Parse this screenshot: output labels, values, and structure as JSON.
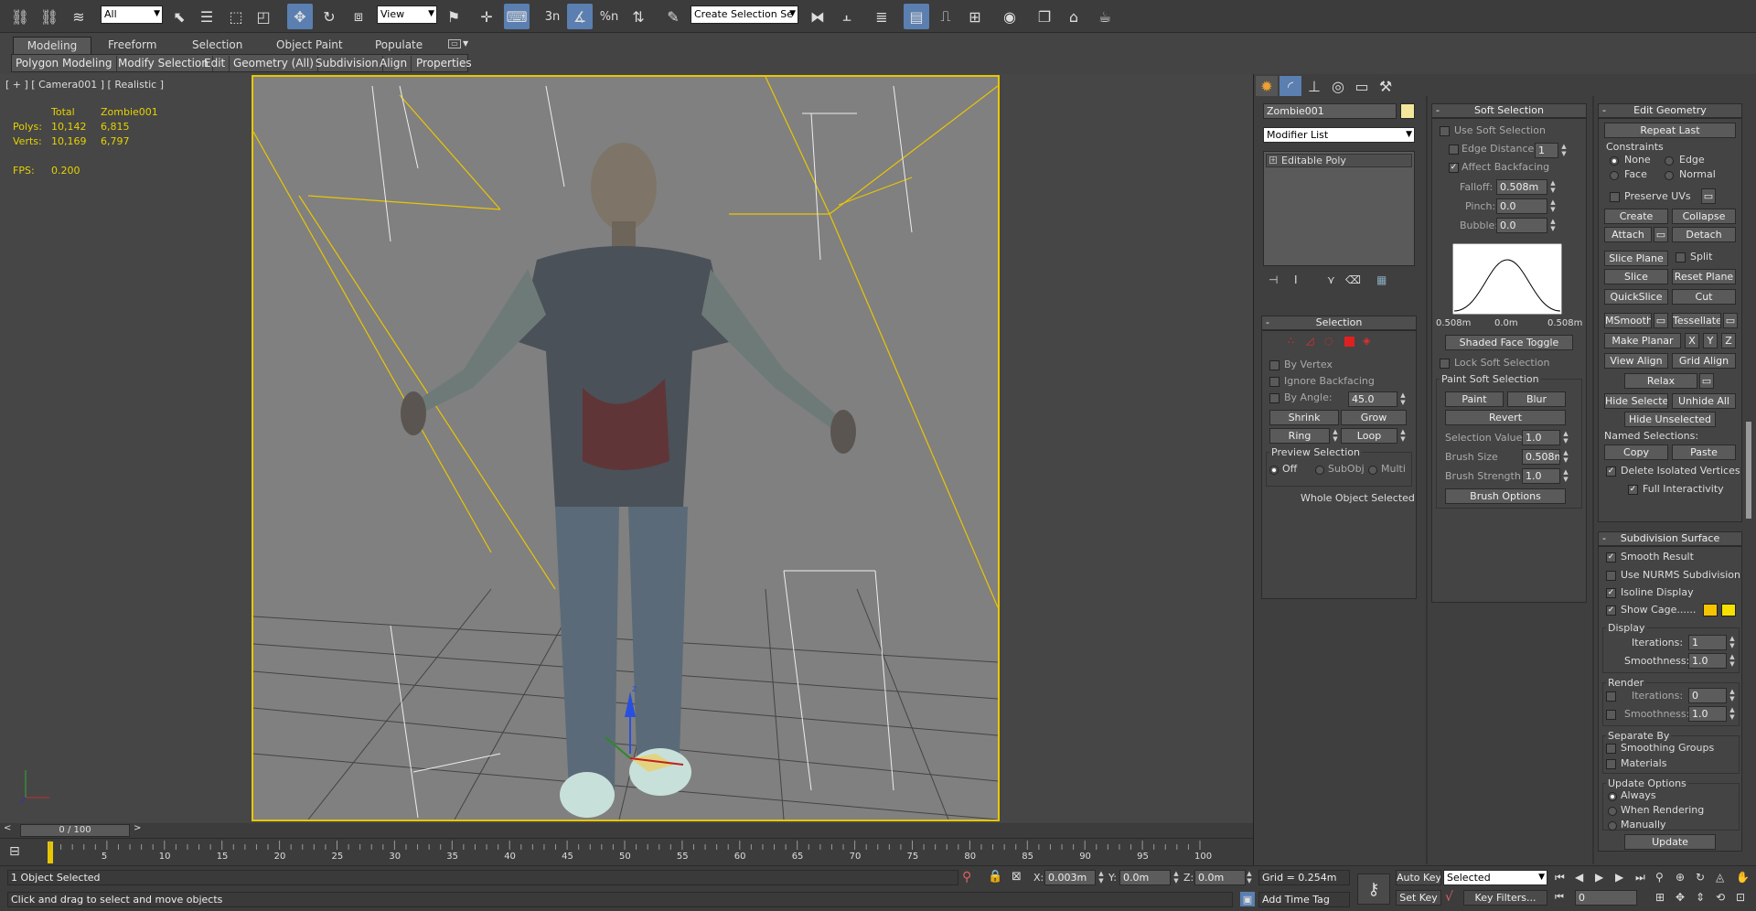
{
  "toolbar": {
    "filter_dropdown": "All",
    "ref_coord_dropdown": "View",
    "selection_set_dropdown": "Create Selection Se",
    "snap_label": "3n",
    "percent_snap_label": "%n"
  },
  "ribbon": {
    "tabs": [
      "Modeling",
      "Freeform",
      "Selection",
      "Object Paint",
      "Populate"
    ],
    "sub_tabs": [
      "Polygon Modeling",
      "Modify Selection",
      "Edit",
      "Geometry (All)",
      "Subdivision",
      "Align",
      "Properties"
    ]
  },
  "viewport": {
    "label": "[ + ] [ Camera001 ] [ Realistic ]",
    "stats": {
      "total_header": "Total",
      "object_header": "Zombie001",
      "polys_label": "Polys:",
      "polys_total": "10,142",
      "polys_object": "6,815",
      "verts_label": "Verts:",
      "verts_total": "10,169",
      "verts_object": "6,797",
      "fps_label": "FPS:",
      "fps_value": "0.200"
    },
    "gizmo_z": "z"
  },
  "timeline": {
    "slider_label": "0 / 100",
    "ticks": [
      "5",
      "10",
      "15",
      "20",
      "25",
      "30",
      "35",
      "40",
      "45",
      "50",
      "55",
      "60",
      "65",
      "70",
      "75",
      "80",
      "85",
      "90",
      "95",
      "100"
    ]
  },
  "status": {
    "selection_count": "1 Object Selected",
    "prompt": "Click and drag to select and move objects",
    "x_label": "X:",
    "x_value": "0.003m",
    "y_label": "Y:",
    "y_value": "0.0m",
    "z_label": "Z:",
    "z_value": "0.0m",
    "grid": "Grid = 0.254m",
    "add_time_tag": "Add Time Tag",
    "auto_key": "Auto Key",
    "set_key": "Set Key",
    "selected_dropdown": "Selected",
    "key_filters": "Key Filters...",
    "frame_value": "0"
  },
  "modifier_panel": {
    "object_name": "Zombie001",
    "object_color": "#f3e79c",
    "modifier_list": "Modifier List",
    "stack_item": "Editable Poly",
    "selection": {
      "title": "Selection",
      "by_vertex": "By Vertex",
      "ignore_backfacing": "Ignore Backfacing",
      "by_angle": "By Angle:",
      "angle_value": "45.0",
      "shrink": "Shrink",
      "grow": "Grow",
      "ring": "Ring",
      "loop": "Loop",
      "preview_title": "Preview Selection",
      "preview_off": "Off",
      "preview_subobj": "SubObj",
      "preview_multi": "Multi",
      "status": "Whole Object Selected"
    }
  },
  "soft_selection": {
    "title": "Soft Selection",
    "use_soft": "Use Soft Selection",
    "edge_distance": "Edge Distance:",
    "edge_distance_value": "1",
    "affect_backfacing": "Affect Backfacing",
    "falloff": "Falloff:",
    "falloff_value": "0.508m",
    "pinch": "Pinch:",
    "pinch_value": "0.0",
    "bubble": "Bubble:",
    "bubble_value": "0.0",
    "curve_left": "0.508m",
    "curve_mid": "0.0m",
    "curve_right": "0.508m",
    "shaded_face_toggle": "Shaded Face Toggle",
    "lock_soft": "Lock Soft Selection",
    "paint_title": "Paint Soft Selection",
    "paint": "Paint",
    "blur": "Blur",
    "revert": "Revert",
    "selection_value": "Selection Value",
    "selection_value_num": "1.0",
    "brush_size": "Brush Size",
    "brush_size_num": "0.508m",
    "brush_strength": "Brush Strength",
    "brush_strength_num": "1.0",
    "brush_options": "Brush Options"
  },
  "edit_geometry": {
    "title": "Edit Geometry",
    "repeat_last": "Repeat Last",
    "constraints": "Constraints",
    "none": "None",
    "edge": "Edge",
    "face": "Face",
    "normal": "Normal",
    "preserve_uvs": "Preserve UVs",
    "create": "Create",
    "collapse": "Collapse",
    "attach": "Attach",
    "detach": "Detach",
    "slice_plane": "Slice Plane",
    "split": "Split",
    "slice": "Slice",
    "reset_plane": "Reset Plane",
    "quickslice": "QuickSlice",
    "cut": "Cut",
    "msmooth": "MSmooth",
    "tessellate": "Tessellate",
    "make_planar": "Make Planar",
    "x": "X",
    "y": "Y",
    "z": "Z",
    "view_align": "View Align",
    "grid_align": "Grid Align",
    "relax": "Relax",
    "hide_selected": "Hide Selected",
    "unhide_all": "Unhide All",
    "hide_unselected": "Hide Unselected",
    "named_selections": "Named Selections:",
    "copy": "Copy",
    "paste": "Paste",
    "delete_isolated": "Delete Isolated Vertices",
    "full_interactivity": "Full Interactivity"
  },
  "subdivision": {
    "title": "Subdivision Surface",
    "smooth_result": "Smooth Result",
    "use_nurms": "Use NURMS Subdivision",
    "isoline_display": "Isoline Display",
    "show_cage": "Show Cage......",
    "cage_color_1": "#f5c400",
    "cage_color_2": "#f5e000",
    "display": "Display",
    "iterations": "Iterations:",
    "display_iterations": "1",
    "smoothness": "Smoothness:",
    "display_smoothness": "1.0",
    "render": "Render",
    "render_iterations": "0",
    "render_smoothness": "1.0",
    "separate_by": "Separate By",
    "smoothing_groups": "Smoothing Groups",
    "materials": "Materials",
    "update_options": "Update Options",
    "always": "Always",
    "when_rendering": "When Rendering",
    "manually": "Manually",
    "update": "Update"
  },
  "colors": {
    "viewport_border": "#e9c600",
    "stats_text": "#e6d200",
    "accent": "#5a7fb0"
  }
}
